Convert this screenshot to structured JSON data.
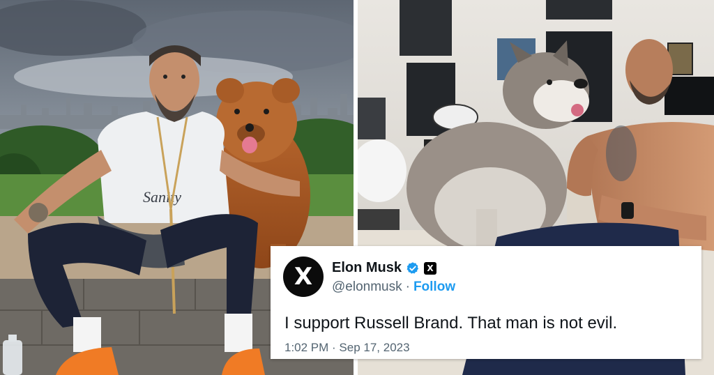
{
  "tweet": {
    "display_name": "Elon Musk",
    "handle": "@elonmusk",
    "separator": "·",
    "follow_label": "Follow",
    "text": "I support Russell Brand. That man is not evil.",
    "timestamp": "1:02 PM · Sep 17, 2023",
    "avatar_glyph": "X",
    "org_badge_glyph": "X",
    "verified_color": "#1d9bf0"
  },
  "left_photo": {
    "shirt_text": "Sanity"
  }
}
